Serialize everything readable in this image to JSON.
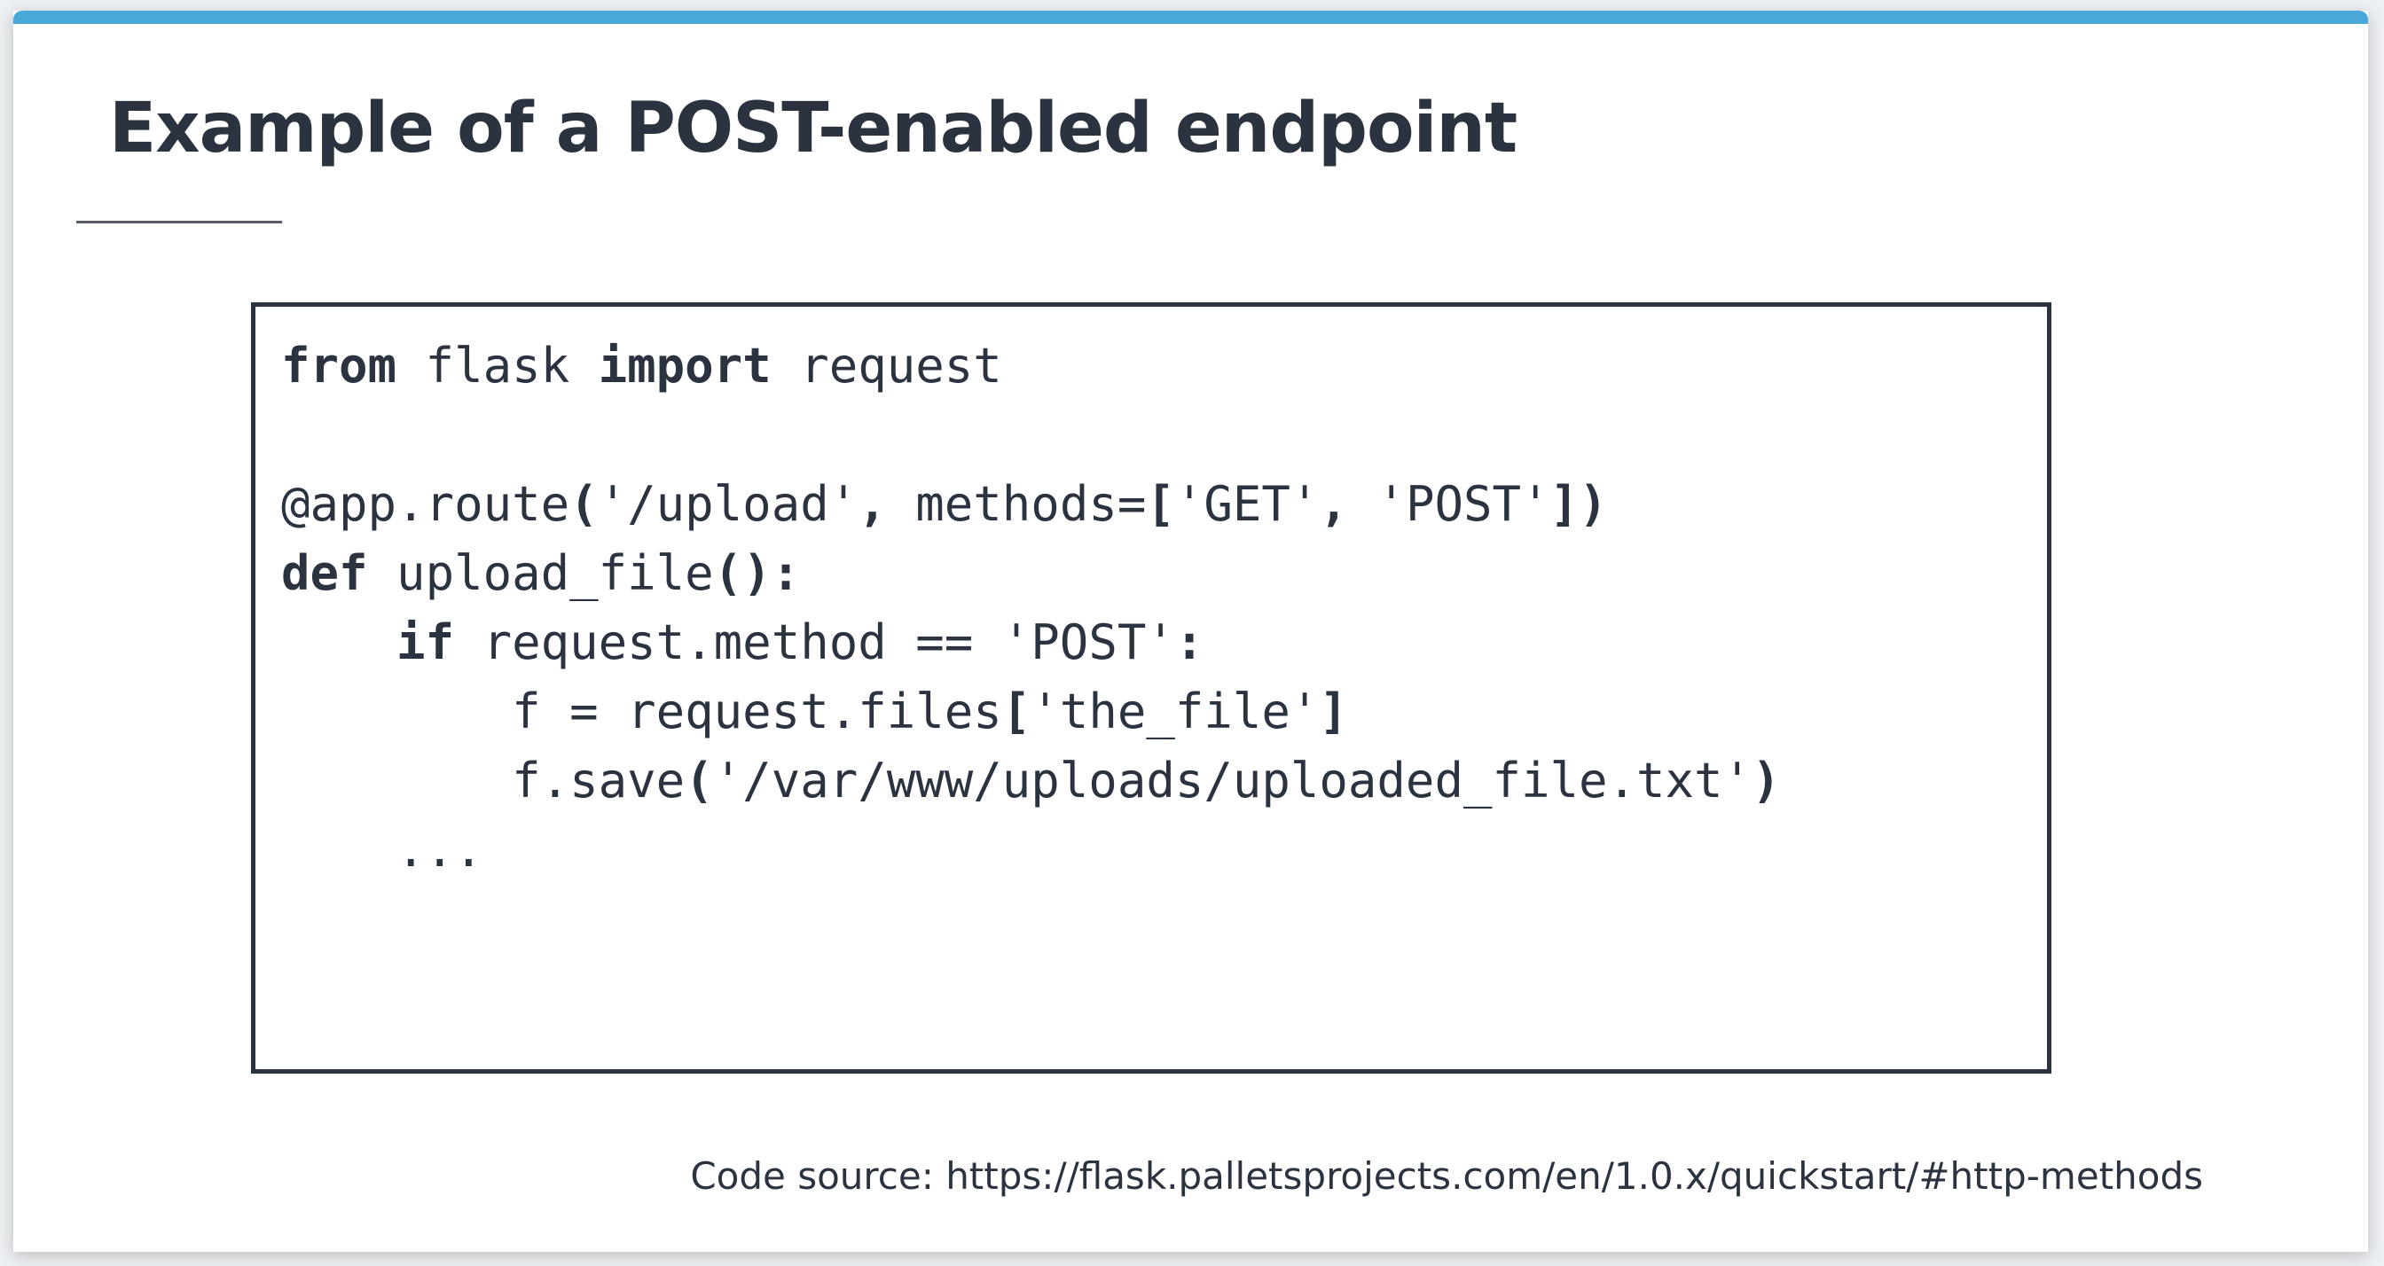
{
  "slide": {
    "title": "Example of a POST-enabled endpoint",
    "source": "Code source: https://flask.palletsprojects.com/en/1.0.x/quickstart/#http-methods"
  },
  "code": {
    "line1": {
      "kw1": "from",
      "t1": " flask ",
      "kw2": "import",
      "t2": " request"
    },
    "line3": {
      "t1": "@app.route",
      "p1": "(",
      "t2": "'/upload'",
      "p2": ",",
      "t3": " methods=",
      "p3": "[",
      "t4": "'GET'",
      "p4": ",",
      "t5": " 'POST'",
      "p5": "])"
    },
    "line4": {
      "kw1": "def",
      "t1": " upload_file",
      "p1": "():"
    },
    "line5": {
      "indent": "    ",
      "kw1": "if",
      "t1": " request.method == 'POST'",
      "p1": ":"
    },
    "line6": {
      "t1": "        f = request.files",
      "p1": "[",
      "t2": "'the_file'",
      "p2": "]"
    },
    "line7": {
      "t1": "        f.save",
      "p1": "(",
      "t2": "'/var/www/uploads/uploaded_file.txt'",
      "p2": ")"
    },
    "line8": {
      "t1": "    ..."
    }
  },
  "colors": {
    "accent": "#4aa8d8",
    "text": "#2c3340",
    "page_background": "#eef1f4"
  }
}
